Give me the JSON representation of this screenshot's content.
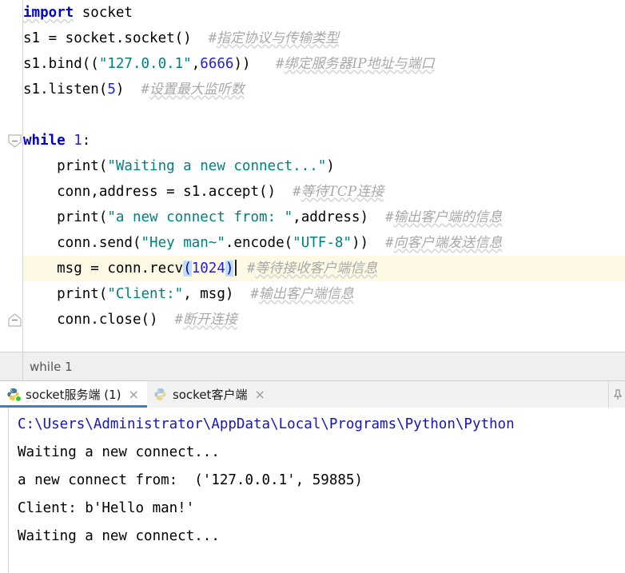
{
  "editor": {
    "lines": [
      {
        "id": "line-import",
        "tokens": [
          {
            "t": "import",
            "c": "kw squig"
          },
          {
            "t": " socket",
            "c": "plain"
          }
        ]
      },
      {
        "id": "line-socket-create",
        "tokens": [
          {
            "t": "s1 = socket.socket()",
            "c": "plain"
          },
          {
            "t": "  ",
            "c": "plain"
          },
          {
            "t": "#",
            "c": "cmt cmt-hash"
          },
          {
            "t": "指定协议与传输类型",
            "c": "cmt squig"
          }
        ]
      },
      {
        "id": "line-bind",
        "tokens": [
          {
            "t": "s1.bind((",
            "c": "plain"
          },
          {
            "t": "\"127.0.0.1\"",
            "c": "str"
          },
          {
            "t": ",",
            "c": "plain"
          },
          {
            "t": "6666",
            "c": "num"
          },
          {
            "t": "))",
            "c": "plain"
          },
          {
            "t": "   ",
            "c": "plain"
          },
          {
            "t": "#",
            "c": "cmt cmt-hash"
          },
          {
            "t": "绑定服务器IP地址与端口",
            "c": "cmt squig"
          }
        ]
      },
      {
        "id": "line-listen",
        "tokens": [
          {
            "t": "s1.listen(",
            "c": "plain"
          },
          {
            "t": "5",
            "c": "num"
          },
          {
            "t": ")",
            "c": "plain"
          },
          {
            "t": "  ",
            "c": "plain"
          },
          {
            "t": "#",
            "c": "cmt cmt-hash"
          },
          {
            "t": "设置最大监听数",
            "c": "cmt squig"
          }
        ]
      },
      {
        "id": "line-blank-1",
        "tokens": []
      },
      {
        "id": "line-while",
        "tokens": [
          {
            "t": "while",
            "c": "kw"
          },
          {
            "t": " ",
            "c": "plain"
          },
          {
            "t": "1",
            "c": "num"
          },
          {
            "t": ":",
            "c": "plain"
          }
        ]
      },
      {
        "id": "line-print-waiting",
        "tokens": [
          {
            "t": "    print(",
            "c": "plain"
          },
          {
            "t": "\"Waiting a new connect...\"",
            "c": "str"
          },
          {
            "t": ")",
            "c": "plain"
          }
        ]
      },
      {
        "id": "line-accept",
        "tokens": [
          {
            "t": "    conn,address = s1.accept()",
            "c": "plain"
          },
          {
            "t": "  ",
            "c": "plain"
          },
          {
            "t": "#",
            "c": "cmt cmt-hash"
          },
          {
            "t": "等待TCP连接",
            "c": "cmt squig"
          }
        ]
      },
      {
        "id": "line-print-from",
        "tokens": [
          {
            "t": "    print(",
            "c": "plain"
          },
          {
            "t": "\"a new connect from: \"",
            "c": "str"
          },
          {
            "t": ",address)",
            "c": "plain"
          },
          {
            "t": "  ",
            "c": "plain"
          },
          {
            "t": "#",
            "c": "cmt cmt-hash"
          },
          {
            "t": "输出客户端的信息",
            "c": "cmt squig"
          }
        ]
      },
      {
        "id": "line-send",
        "tokens": [
          {
            "t": "    conn.send(",
            "c": "plain"
          },
          {
            "t": "\"Hey man~\"",
            "c": "str"
          },
          {
            "t": ".encode(",
            "c": "plain"
          },
          {
            "t": "\"UTF-8\"",
            "c": "str"
          },
          {
            "t": "))",
            "c": "plain"
          },
          {
            "t": "  ",
            "c": "plain"
          },
          {
            "t": "#",
            "c": "cmt cmt-hash"
          },
          {
            "t": "向客户端发送信息",
            "c": "cmt squig"
          }
        ]
      },
      {
        "id": "line-recv",
        "current": true,
        "tokens": [
          {
            "t": "    msg = conn.recv",
            "c": "plain"
          },
          {
            "t": "(",
            "c": "bracket"
          },
          {
            "t": "1024",
            "c": "num"
          },
          {
            "t": ")",
            "c": "bracket"
          },
          {
            "t": "__CARET__",
            "c": "caret"
          },
          {
            "t": " ",
            "c": "plain"
          },
          {
            "t": "#",
            "c": "cmt cmt-hash"
          },
          {
            "t": "等待接收客户端信息",
            "c": "cmt squig"
          }
        ]
      },
      {
        "id": "line-print-client",
        "tokens": [
          {
            "t": "    print(",
            "c": "plain"
          },
          {
            "t": "\"Client:\"",
            "c": "str"
          },
          {
            "t": ", msg)",
            "c": "plain"
          },
          {
            "t": "  ",
            "c": "plain"
          },
          {
            "t": "#",
            "c": "cmt cmt-hash"
          },
          {
            "t": "输出客户端信息",
            "c": "cmt squig"
          }
        ]
      },
      {
        "id": "line-close",
        "tokens": [
          {
            "t": "    conn.close()",
            "c": "plain"
          },
          {
            "t": "  ",
            "c": "plain"
          },
          {
            "t": "#",
            "c": "cmt cmt-hash"
          },
          {
            "t": "断开连接",
            "c": "cmt squig"
          }
        ]
      }
    ],
    "fold_markers": [
      {
        "name": "fold-collapse-while",
        "line_index": 5,
        "direction": "down"
      },
      {
        "name": "fold-end-while",
        "line_index": 12,
        "direction": "up"
      }
    ]
  },
  "breadcrumb": {
    "path": "while 1"
  },
  "tabs": [
    {
      "id": "tab-socket-server",
      "label": "socket服务端 (1)",
      "icon": "python-icon",
      "active": true,
      "running": true,
      "close_glyph": "×"
    },
    {
      "id": "tab-socket-client",
      "label": "socket客户端",
      "icon": "python-icon",
      "active": false,
      "running": false,
      "close_glyph": "×"
    }
  ],
  "console": {
    "lines": [
      {
        "text": "C:\\Users\\Administrator\\AppData\\Local\\Programs\\Python\\Python",
        "link": true
      },
      {
        "text": "Waiting a new connect...",
        "link": false
      },
      {
        "text": "a new connect from:  ('127.0.0.1', 59885)",
        "link": false
      },
      {
        "text": "Client: b'Hello man!'",
        "link": false
      },
      {
        "text": "Waiting a new connect...",
        "link": false
      }
    ]
  },
  "colors": {
    "keyword": "#0000d0",
    "string": "#008080",
    "number": "#2222dd",
    "comment": "#a8a8a8",
    "current_line": "#fdf9e4",
    "bracket_match": "#bfdfff",
    "tab_underline": "#3d7ebf",
    "run_badge": "#32c832",
    "console_link": "#1414c8"
  }
}
